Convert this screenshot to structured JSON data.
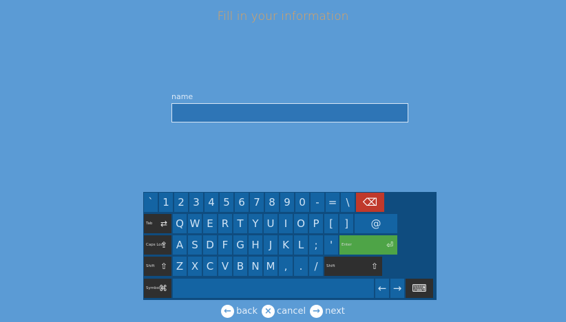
{
  "title": "Fill in your information",
  "form": {
    "name_label": "name",
    "name_value": ""
  },
  "keyboard": {
    "row1": [
      "`",
      "1",
      "2",
      "3",
      "4",
      "5",
      "6",
      "7",
      "8",
      "9",
      "0",
      "-",
      "=",
      "\\"
    ],
    "row2": [
      "Q",
      "W",
      "E",
      "R",
      "T",
      "Y",
      "U",
      "I",
      "O",
      "P",
      "[",
      "]"
    ],
    "row3": [
      "A",
      "S",
      "D",
      "F",
      "G",
      "H",
      "J",
      "K",
      "L",
      ";",
      "'"
    ],
    "row4": [
      "Z",
      "X",
      "C",
      "V",
      "B",
      "N",
      "M",
      ",",
      ".",
      "/"
    ],
    "backspace": "⌫",
    "tab_label": "Tab",
    "tab_symbol": "⇄",
    "at": "@",
    "caps_label": "Caps Lock",
    "caps_symbol": "⇪",
    "enter_label": "Enter",
    "enter_symbol": "⏎",
    "shift_label": "Shift",
    "shift_symbol": "⇧",
    "symbols_label": "Symbols",
    "symbols_symbol": "⌘",
    "left_arrow": "←",
    "right_arrow": "→",
    "keyboard_icon": "⌨"
  },
  "footer": {
    "back_icon": "←",
    "back": "back",
    "cancel_icon": "×",
    "cancel": "cancel",
    "next_icon": "→",
    "next": "next"
  },
  "colors": {
    "background": "#5b9bd5",
    "title": "#e0a25a",
    "key": "#1464a3",
    "key_dark": "#2f2f2f",
    "backspace": "#c0392b",
    "enter": "#4ea447"
  }
}
